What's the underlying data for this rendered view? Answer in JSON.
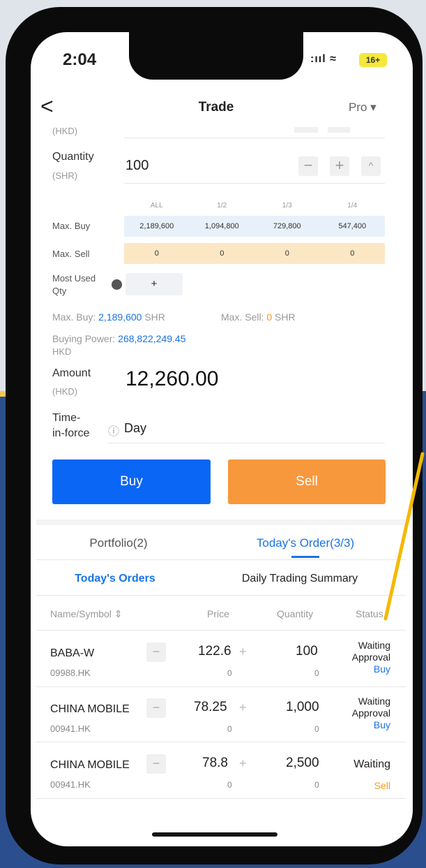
{
  "status_bar": {
    "time": "2:04",
    "signal": ":ııl ≈",
    "battery": "16+"
  },
  "nav": {
    "back": "<",
    "title": "Trade",
    "pro": "Pro ▾"
  },
  "price_unit_partial": "(HKD)",
  "quantity": {
    "label": "Quantity",
    "unit": "(SHR)",
    "value": "100",
    "minus": "−",
    "plus": "+",
    "expand": "^"
  },
  "grid": {
    "headers": [
      "ALL",
      "1/2",
      "1/3",
      "1/4"
    ],
    "max_buy_label": "Max. Buy",
    "max_buy": [
      "2,189,600",
      "1,094,800",
      "729,800",
      "547,400"
    ],
    "max_sell_label": "Max. Sell",
    "max_sell": [
      "0",
      "0",
      "0",
      "0"
    ]
  },
  "most_used": {
    "label_1": "Most Used",
    "label_2": "Qty",
    "add": "+"
  },
  "summary": {
    "max_buy_prefix": "Max. Buy: ",
    "max_buy_value": "2,189,600",
    "max_buy_unit": " SHR",
    "max_sell_prefix": "Max. Sell: ",
    "max_sell_value": "0",
    "max_sell_unit": " SHR",
    "buying_power_prefix": "Buying Power: ",
    "buying_power_value": "268,822,249.45",
    "buying_power_unit": "HKD"
  },
  "amount": {
    "label": "Amount",
    "unit": "(HKD)",
    "value": "12,260.00"
  },
  "time_in_force": {
    "label_1": "Time-",
    "label_2": "in-force",
    "info": "ⓘ",
    "value": "Day"
  },
  "actions": {
    "buy": "Buy",
    "sell": "Sell"
  },
  "tabs": {
    "portfolio": "Portfolio(2)",
    "todays_order": "Today's Order(3/3)"
  },
  "subtabs": {
    "todays_orders": "Today's Orders",
    "daily_summary": "Daily Trading Summary"
  },
  "table": {
    "headers": {
      "name": "Name/Symbol ⇕",
      "price": "Price",
      "quantity": "Quantity",
      "status": "Status"
    },
    "rows": [
      {
        "name": "BABA-W",
        "symbol": "09988.HK",
        "price": "122.6",
        "price_filled": "0",
        "qty": "100",
        "qty_filled": "0",
        "status_1": "Waiting",
        "status_2": "Approval",
        "side": "Buy"
      },
      {
        "name": "CHINA MOBILE",
        "symbol": "00941.HK",
        "price": "78.25",
        "price_filled": "0",
        "qty": "1,000",
        "qty_filled": "0",
        "status_1": "Waiting",
        "status_2": "Approval",
        "side": "Buy"
      },
      {
        "name": "CHINA MOBILE",
        "symbol": "00941.HK",
        "price": "78.8",
        "price_filled": "0",
        "qty": "2,500",
        "qty_filled": "0",
        "status_1": "Waiting",
        "status_2": "",
        "side": "Sell"
      }
    ],
    "minus": "−",
    "plus": "+"
  },
  "colors": {
    "buy": "#0a66f5",
    "sell": "#f7983d",
    "accent_blue": "#1a73e8",
    "annotation": "#f5b800"
  }
}
